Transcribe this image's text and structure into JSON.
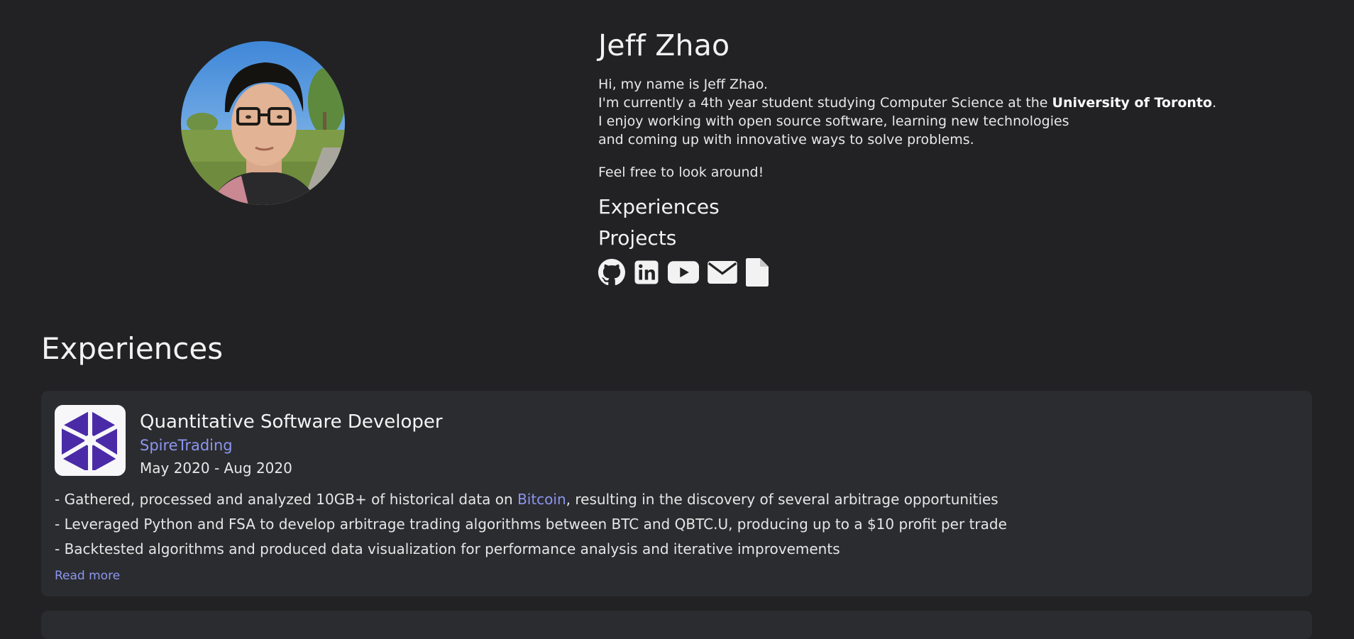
{
  "profile": {
    "name": "Jeff Zhao",
    "bio": {
      "line1": "Hi, my name is Jeff Zhao.",
      "line2_prefix": "I'm currently a 4th year student studying Computer Science at the ",
      "line2_university": "University of Toronto",
      "line2_suffix": ".",
      "line3": "I enjoy working with open source software, learning new technologies",
      "line4": "and coming up with innovative ways to solve problems.",
      "line5": "Feel free to look around!"
    }
  },
  "nav": {
    "experiences": "Experiences",
    "projects": "Projects"
  },
  "socials": [
    "github-icon",
    "linkedin-icon",
    "youtube-icon",
    "email-icon",
    "resume-icon"
  ],
  "colors": {
    "background": "#222224",
    "card": "#2b2c2f",
    "link": "#8c96f0",
    "logo_purple": "#4b2aa8"
  },
  "experiences_section": {
    "title": "Experiences",
    "items": [
      {
        "logo": "spiretrading-logo",
        "title": "Quantitative Software Developer",
        "company": "SpireTrading",
        "dates": "May 2020 - Aug 2020",
        "bullet1_prefix": "- Gathered, processed and analyzed 10GB+ of historical data on ",
        "bullet1_link": "Bitcoin",
        "bullet1_suffix": ", resulting in the discovery of several arbitrage opportunities",
        "bullet2": "- Leveraged Python and FSA to develop arbitrage trading algorithms between BTC and QBTC.U, producing up to a $10 profit per trade",
        "bullet3": "- Backtested algorithms and produced data visualization for performance analysis and iterative improvements",
        "read_more": "Read more"
      }
    ]
  }
}
